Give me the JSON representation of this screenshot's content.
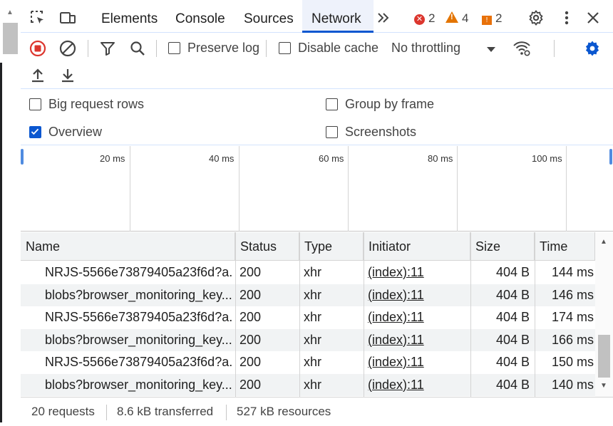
{
  "tabs": {
    "items": [
      "Elements",
      "Console",
      "Sources",
      "Network"
    ],
    "active": "Network"
  },
  "counts": {
    "errors": "2",
    "warnings": "4",
    "issues": "2"
  },
  "toolbar": {
    "preserve_log": "Preserve log",
    "disable_cache": "Disable cache",
    "throttling": "No throttling"
  },
  "settings": {
    "big_rows": "Big request rows",
    "group_by_frame": "Group by frame",
    "overview": "Overview",
    "screenshots": "Screenshots",
    "overview_checked": true
  },
  "overview": {
    "ticks": [
      "20 ms",
      "40 ms",
      "60 ms",
      "80 ms",
      "100 ms"
    ]
  },
  "table": {
    "columns": [
      "Name",
      "Status",
      "Type",
      "Initiator",
      "Size",
      "Time"
    ],
    "rows": [
      {
        "name": "NRJS-5566e73879405a23f6d?a...",
        "status": "200",
        "type": "xhr",
        "initiator": "(index):11",
        "size": "404 B",
        "time": "144 ms"
      },
      {
        "name": "blobs?browser_monitoring_key...",
        "status": "200",
        "type": "xhr",
        "initiator": "(index):11",
        "size": "404 B",
        "time": "146 ms"
      },
      {
        "name": "NRJS-5566e73879405a23f6d?a...",
        "status": "200",
        "type": "xhr",
        "initiator": "(index):11",
        "size": "404 B",
        "time": "174 ms"
      },
      {
        "name": "blobs?browser_monitoring_key...",
        "status": "200",
        "type": "xhr",
        "initiator": "(index):11",
        "size": "404 B",
        "time": "166 ms"
      },
      {
        "name": "NRJS-5566e73879405a23f6d?a...",
        "status": "200",
        "type": "xhr",
        "initiator": "(index):11",
        "size": "404 B",
        "time": "150 ms"
      },
      {
        "name": "blobs?browser_monitoring_key...",
        "status": "200",
        "type": "xhr",
        "initiator": "(index):11",
        "size": "404 B",
        "time": "140 ms"
      }
    ]
  },
  "status": {
    "requests": "20 requests",
    "transferred": "8.6 kB transferred",
    "resources": "527 kB resources"
  },
  "colors": {
    "accent": "#0b57d0",
    "record": "#dc362e"
  },
  "icons": [
    "inspect-icon",
    "device-toggle-icon",
    "more-tabs-icon",
    "gear-icon",
    "kebab-menu-icon",
    "close-icon",
    "record-icon",
    "clear-icon",
    "filter-icon",
    "search-icon",
    "dropdown-arrow-icon",
    "network-conditions-icon",
    "network-settings-icon",
    "import-har-icon",
    "export-har-icon"
  ]
}
